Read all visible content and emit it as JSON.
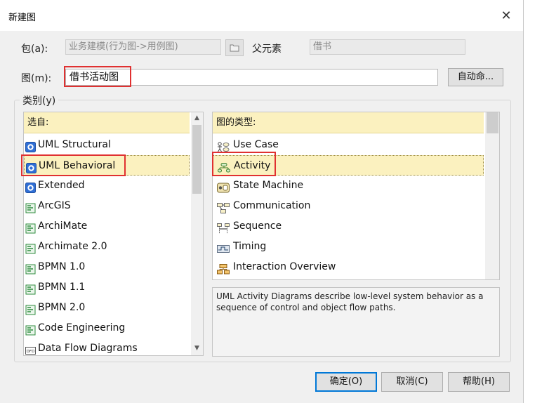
{
  "window": {
    "title": "新建图"
  },
  "package": {
    "label": "包(a):",
    "value": "业务建模(行为图->用例图)"
  },
  "parent": {
    "label": "父元素",
    "value": "借书"
  },
  "diagram": {
    "label": "图(m):",
    "value": "借书活动图",
    "auto_name_button": "自动命..."
  },
  "category": {
    "label": "类别(y)"
  },
  "left_list": {
    "header": "选自:",
    "items": [
      {
        "label": "UML Structural",
        "icon": "uml-icon"
      },
      {
        "label": "UML Behavioral",
        "icon": "uml-icon"
      },
      {
        "label": "Extended",
        "icon": "uml-icon"
      },
      {
        "label": "ArcGIS",
        "icon": "diagram-icon"
      },
      {
        "label": "ArchiMate",
        "icon": "diagram-icon"
      },
      {
        "label": "Archimate 2.0",
        "icon": "diagram-icon"
      },
      {
        "label": "BPMN 1.0",
        "icon": "diagram-icon"
      },
      {
        "label": "BPMN 1.1",
        "icon": "diagram-icon"
      },
      {
        "label": "BPMN 2.0",
        "icon": "diagram-icon"
      },
      {
        "label": "Code Engineering",
        "icon": "diagram-icon"
      },
      {
        "label": "Data Flow Diagrams",
        "icon": "dfd-icon"
      }
    ],
    "selected_index": 1
  },
  "right_list": {
    "header": "图的类型:",
    "items": [
      {
        "label": "Use Case",
        "icon": "use-case-icon"
      },
      {
        "label": "Activity",
        "icon": "activity-icon"
      },
      {
        "label": "State Machine",
        "icon": "state-machine-icon"
      },
      {
        "label": "Communication",
        "icon": "communication-icon"
      },
      {
        "label": "Sequence",
        "icon": "sequence-icon"
      },
      {
        "label": "Timing",
        "icon": "timing-icon"
      },
      {
        "label": "Interaction Overview",
        "icon": "interaction-overview-icon"
      }
    ],
    "selected_index": 1
  },
  "description": "UML Activity Diagrams describe low-level system behavior as a sequence of control and object flow paths.",
  "buttons": {
    "ok": "确定(O)",
    "cancel": "取消(C)",
    "help": "帮助(H)"
  }
}
